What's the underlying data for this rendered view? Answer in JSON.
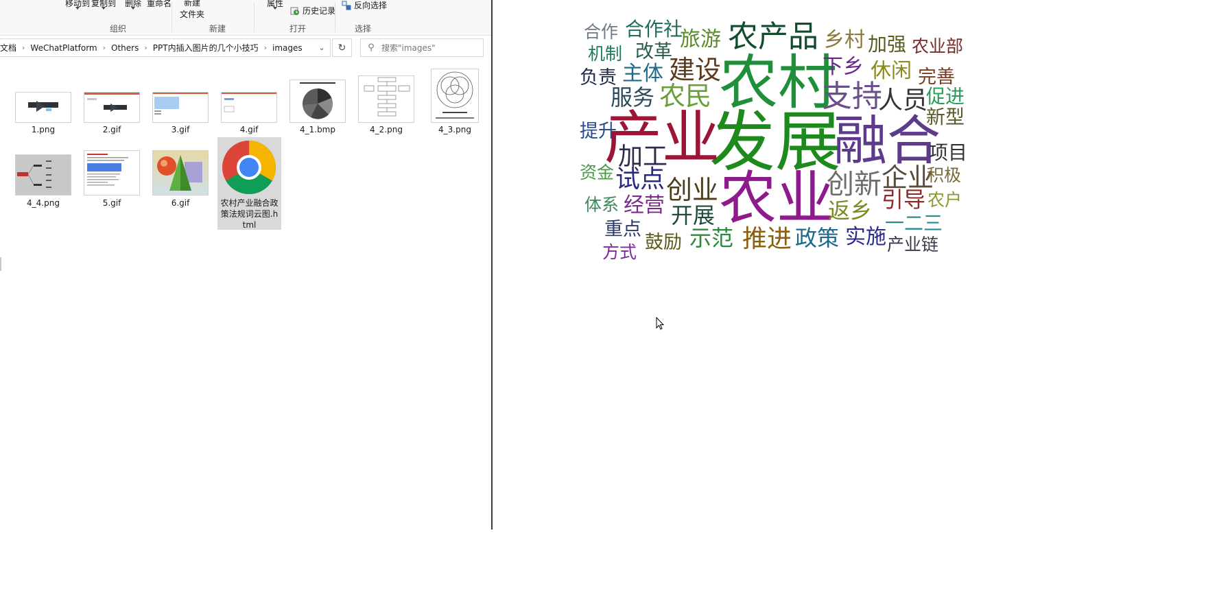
{
  "ribbon": {
    "move_to": "移动到",
    "copy_to": "复制到",
    "delete": "删除",
    "rename": "重命名",
    "new_folder_top": "新建",
    "new_folder_bottom": "文件夹",
    "properties": "属性",
    "history": "历史记录",
    "invert_selection": "反向选择",
    "group_organize": "组织",
    "group_new": "新建",
    "group_open": "打开",
    "group_select": "选择"
  },
  "address": {
    "crumbs": [
      "文档",
      "WeChatPlatform",
      "Others",
      "PPT内插入图片的几个小技巧",
      "images"
    ]
  },
  "search": {
    "placeholder": "搜索\"images\""
  },
  "files": [
    {
      "name": "1.png"
    },
    {
      "name": "2.gif"
    },
    {
      "name": "3.gif"
    },
    {
      "name": "4.gif"
    },
    {
      "name": "4_1.bmp"
    },
    {
      "name": "4_2.png"
    },
    {
      "name": "4_3.png"
    },
    {
      "name": "4_4.png"
    },
    {
      "name": "5.gif"
    },
    {
      "name": "6.gif"
    },
    {
      "name": "农村产业融合政策法规词云图.html"
    }
  ],
  "colors": {
    "selection": "#d9d9d9",
    "divider": "#3a3a3a"
  },
  "wordcloud": {
    "words": [
      {
        "text": "发展",
        "color": "#1e8a1e"
      },
      {
        "text": "产业",
        "color": "#9c1537"
      },
      {
        "text": "农村",
        "color": "#1f8f3a"
      },
      {
        "text": "融合",
        "color": "#5e3a8c"
      },
      {
        "text": "农业",
        "color": "#8e1a8e"
      },
      {
        "text": "农产品",
        "color": "#114d2c"
      },
      {
        "text": "支持",
        "color": "#6b4f8a"
      },
      {
        "text": "创新",
        "color": "#6e6e6e"
      },
      {
        "text": "企业",
        "color": "#5a4a3a"
      },
      {
        "text": "建设",
        "color": "#5b3a1e"
      },
      {
        "text": "创业",
        "color": "#4d3f1e"
      },
      {
        "text": "推进",
        "color": "#8a5f0e"
      },
      {
        "text": "农民",
        "color": "#6a9e3a"
      },
      {
        "text": "加工",
        "color": "#2f2b4f"
      },
      {
        "text": "人员",
        "color": "#333333"
      },
      {
        "text": "合作社",
        "color": "#1e6b5a"
      },
      {
        "text": "旅游",
        "color": "#5a8a2a"
      },
      {
        "text": "乡村",
        "color": "#8a7a3a"
      },
      {
        "text": "加强",
        "color": "#5a5a1e"
      },
      {
        "text": "农业部",
        "color": "#7a2a2a"
      },
      {
        "text": "合作",
        "color": "#6d7a8a"
      },
      {
        "text": "机制",
        "color": "#1e7a5a"
      },
      {
        "text": "改革",
        "color": "#2a5a4a"
      },
      {
        "text": "下乡",
        "color": "#6a2a8a"
      },
      {
        "text": "休闲",
        "color": "#8a8a1e"
      },
      {
        "text": "负责",
        "color": "#1e2a4a"
      },
      {
        "text": "主体",
        "color": "#1e6b8a"
      },
      {
        "text": "完善",
        "color": "#7a3a1e"
      },
      {
        "text": "服务",
        "color": "#2a4a5a"
      },
      {
        "text": "促进",
        "color": "#2a9a5a"
      },
      {
        "text": "新型",
        "color": "#5a5a2a"
      },
      {
        "text": "提升",
        "color": "#2a4a8a"
      },
      {
        "text": "项目",
        "color": "#333333"
      },
      {
        "text": "资金",
        "color": "#4a9a4a"
      },
      {
        "text": "试点",
        "color": "#2a2a7a"
      },
      {
        "text": "积极",
        "color": "#7a6a3a"
      },
      {
        "text": "体系",
        "color": "#3a8a5a"
      },
      {
        "text": "经营",
        "color": "#7a2a8a"
      },
      {
        "text": "返乡",
        "color": "#7a8a1e"
      },
      {
        "text": "引导",
        "color": "#8a2a2a"
      },
      {
        "text": "农户",
        "color": "#8a9a2a"
      },
      {
        "text": "开展",
        "color": "#1e4a3a"
      },
      {
        "text": "一二三",
        "color": "#2a8a8a"
      },
      {
        "text": "重点",
        "color": "#2a3a6a"
      },
      {
        "text": "鼓励",
        "color": "#5a5a1e"
      },
      {
        "text": "示范",
        "color": "#2a8a3a"
      },
      {
        "text": "政策",
        "color": "#1e6a8a"
      },
      {
        "text": "实施",
        "color": "#2a2a8a"
      },
      {
        "text": "产业链",
        "color": "#3a3a4a"
      },
      {
        "text": "方式",
        "color": "#7a2a9a"
      }
    ]
  }
}
